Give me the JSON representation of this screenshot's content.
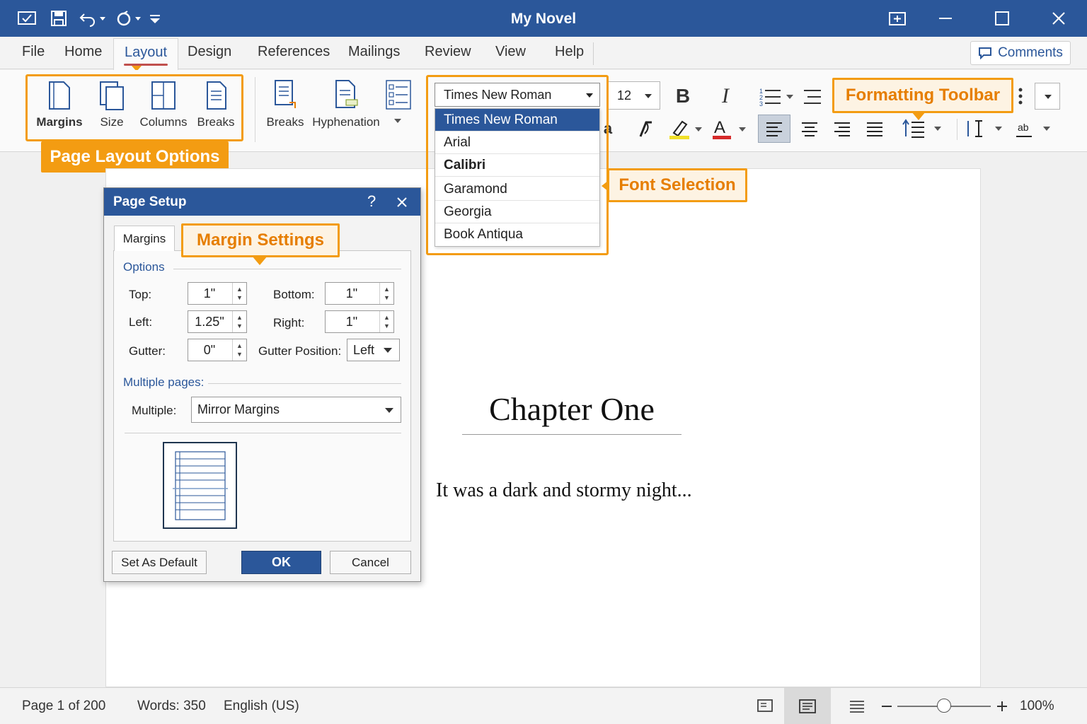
{
  "window": {
    "title": "My Novel",
    "accent": "#2b579a",
    "icons": [
      "autosave-icon",
      "save-icon",
      "undo-icon",
      "redo-icon",
      "customize-icon",
      "restore-icon",
      "minimize-icon",
      "maximize-icon",
      "close-icon"
    ]
  },
  "tabs": [
    {
      "label": "File"
    },
    {
      "label": "Home"
    },
    {
      "label": "Layout",
      "active": true
    },
    {
      "label": "Design"
    },
    {
      "label": "References"
    },
    {
      "label": "Mailings"
    },
    {
      "label": "Review"
    },
    {
      "label": "View"
    },
    {
      "label": "Help"
    }
  ],
  "comments": {
    "label": "Comments"
  },
  "ribbon": {
    "page_setup": [
      "Margins",
      "Size",
      "Columns",
      "Breaks"
    ],
    "paragraph": [
      "Breaks",
      "Hyphenation"
    ]
  },
  "font": {
    "current": "Times New Roman",
    "size": "12",
    "options": [
      "Times New Roman",
      "Arial",
      "Calibri",
      "Garamond",
      "Georgia",
      "Book Antiqua"
    ],
    "selected_index": 0
  },
  "callouts": {
    "page_layout": "Page Layout Options",
    "font_selection": "Font Selection",
    "formatting_toolbar": "Formatting Toolbar",
    "margin_settings": "Margin Settings",
    "color": "#f39c12"
  },
  "document": {
    "heading": "Chapter One",
    "paragraph": "It was a dark and stormy night..."
  },
  "dialog": {
    "title": "Page Setup",
    "help": "?",
    "tab": "Margins",
    "options_label": "Options",
    "top_label": "Top:",
    "top_value": "1\"",
    "bottom_label": "Bottom:",
    "bottom_value": "1\"",
    "left_label": "Left:",
    "left_value": "1.25\"",
    "right_label": "Right:",
    "right_value": "1\"",
    "gutter_label": "Gutter:",
    "gutter_value": "0\"",
    "gutter_pos_label": "Gutter Position:",
    "gutter_pos_value": "Left",
    "multiple_pages_label": "Multiple pages:",
    "multiple_label": "Multiple:",
    "multiple_value": "Mirror Margins",
    "default_btn": "Set As Default",
    "ok_btn": "OK",
    "cancel_btn": "Cancel"
  },
  "status": {
    "page": "Page 1 of 200",
    "words": "Words: 350",
    "language": "English (US)",
    "zoom": "100%",
    "zoom_level": 0.5
  }
}
